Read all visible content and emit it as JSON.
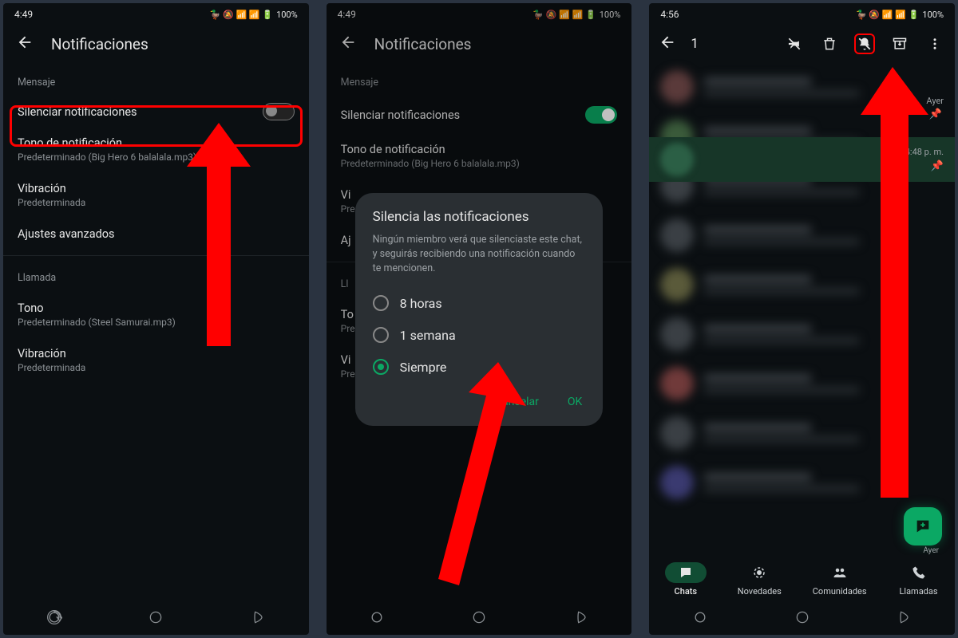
{
  "screen1": {
    "time": "4:49",
    "battery": "100%",
    "title": "Notificaciones",
    "section_msg": "Mensaje",
    "mute_label": "Silenciar notificaciones",
    "tone_title": "Tono de notificación",
    "tone_sub": "Predeterminado (Big Hero 6 balalala.mp3)",
    "vib_title": "Vibración",
    "vib_sub": "Predeterminada",
    "adv_title": "Ajustes avanzados",
    "section_call": "Llamada",
    "calltone_title": "Tono",
    "calltone_sub": "Predeterminado (Steel Samurai.mp3)",
    "callvib_title": "Vibración",
    "callvib_sub": "Predeterminada"
  },
  "screen2": {
    "time": "4:49",
    "battery": "100%",
    "title": "Notificaciones",
    "section_msg": "Mensaje",
    "mute_label": "Silenciar notificaciones",
    "tone_title": "Tono de notificación",
    "tone_sub": "Predeterminado (Big Hero 6 balalala.mp3)",
    "vib_title": "Vi",
    "vib_sub": "Pre",
    "adv_title": "Aj",
    "section_call": "Ll",
    "calltone_title": "To",
    "calltone_sub": "Pre",
    "callvib_title": "Vi",
    "callvib_sub": "Pre",
    "modal_title": "Silencia las notificaciones",
    "modal_desc": "Ningún miembro verá que silenciaste este chat, y seguirás recibiendo una notificación cuando te mencionen.",
    "opt1": "8 horas",
    "opt2": "1 semana",
    "opt3": "Siempre",
    "cancel": "Cancelar",
    "ok": "OK"
  },
  "screen3": {
    "time": "4:56",
    "battery": "100%",
    "count": "1",
    "sel_time": "4:48 p. m.",
    "ayer": "Ayer",
    "tab_chats": "Chats",
    "tab_news": "Novedades",
    "tab_comm": "Comunidades",
    "tab_calls": "Llamadas",
    "fab_bottom": "Ayer"
  }
}
